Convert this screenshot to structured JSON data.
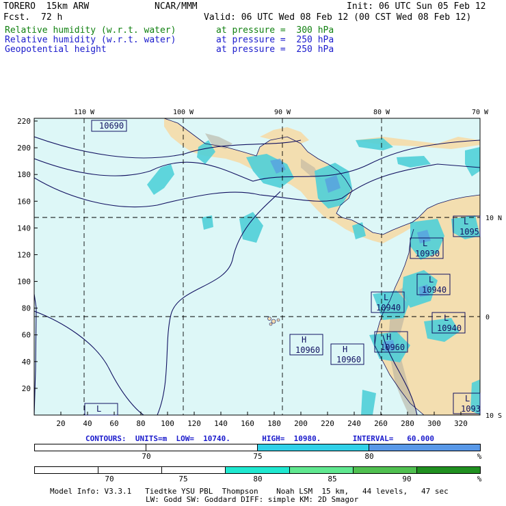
{
  "header": {
    "model": "TORERO  15km ARW",
    "org": "NCAR/MMM",
    "init": "Init: 06 UTC Sun 05 Feb 12",
    "fcst_label": "Fcst.",
    "fcst_value": "72 h",
    "valid": "Valid: 06 UTC Wed 08 Feb 12 (00 CST Wed 08 Feb 12)",
    "fields": [
      {
        "name": "Relative humidity (w.r.t. water)",
        "level": "at pressure =  300 hPa",
        "color": "#108010"
      },
      {
        "name": "Relative humidity (w.r.t. water)",
        "level": "at pressure =  250 hPa",
        "color": "#1a1acc"
      },
      {
        "name": "Geopotential height",
        "level": "at pressure =  250 hPa",
        "color": "#1a1acc"
      }
    ]
  },
  "map": {
    "lon_labels": [
      "110 W",
      "100 W",
      "90 W",
      "80 W",
      "70 W"
    ],
    "lat_labels": [
      "10 N",
      "0",
      "10 S"
    ],
    "y_ticks": [
      "220",
      "200",
      "180",
      "160",
      "140",
      "120",
      "100",
      "80",
      "60",
      "40",
      "20"
    ],
    "x_ticks": [
      "20",
      "40",
      "60",
      "80",
      "100",
      "120",
      "140",
      "160",
      "180",
      "200",
      "220",
      "240",
      "260",
      "280",
      "300",
      "320"
    ],
    "boxes": [
      {
        "type": "",
        "value": "10690"
      },
      {
        "type": "L",
        "value": "10930"
      },
      {
        "type": "L",
        "value": "10940"
      },
      {
        "type": "L",
        "value": "10940"
      },
      {
        "type": "L",
        "value": "10940"
      },
      {
        "type": "H",
        "value": "10960"
      },
      {
        "type": "H",
        "value": "10960"
      },
      {
        "type": "H",
        "value": "10960"
      },
      {
        "type": "L",
        "value": "1095"
      },
      {
        "type": "L",
        "value": "1093"
      },
      {
        "type": "L",
        "value": ""
      }
    ],
    "colors": {
      "ocean": "#ddf7f7",
      "land": "#f3deb0",
      "contour": "#101060",
      "grid": "#000000",
      "rh_low": "#50d0d8",
      "rh_high": "#58a0e0"
    }
  },
  "contours_info": "CONTOURS:  UNITS=m  LOW=  10740.       HIGH=  10980.       INTERVAL=   60.000",
  "colorbar1": {
    "colors": [
      "#ffffff",
      "#ffffff",
      "#30d0e8",
      "#5898e8"
    ],
    "labels": [
      "70",
      "75",
      "80"
    ],
    "unit": "%"
  },
  "colorbar2": {
    "colors": [
      "#ffffff",
      "#ffffff",
      "#ffffff",
      "#20e8d0",
      "#60e890",
      "#50c050",
      "#209020"
    ],
    "labels": [
      "70",
      "75",
      "80",
      "85",
      "90"
    ],
    "unit": "%"
  },
  "footer": {
    "line1": "Model Info: V3.3.1   Tiedtke YSU PBL  Thompson    Noah LSM  15 km,   44 levels,   47 sec",
    "line2": "LW: Godd SW: Goddard DIFF: simple KM: 2D Smagor"
  }
}
